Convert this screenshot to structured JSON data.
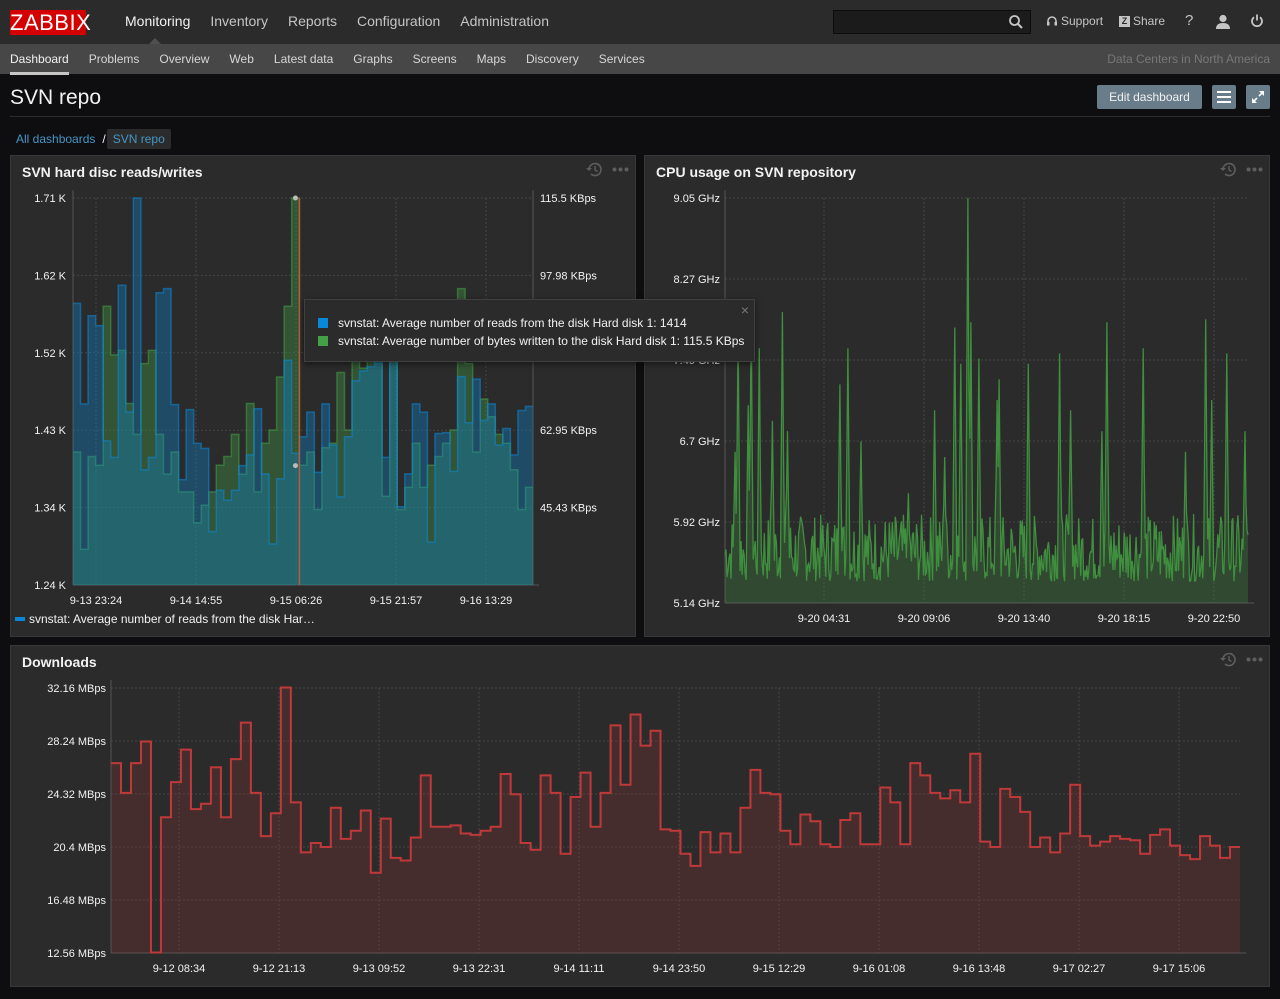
{
  "topnav": {
    "logo": "ZABBIX",
    "menu": [
      "Monitoring",
      "Inventory",
      "Reports",
      "Configuration",
      "Administration"
    ],
    "active_menu": 0,
    "search": {
      "value": "",
      "placeholder": ""
    },
    "support_label": "Support",
    "share_label": "Share",
    "share_badge": "Z",
    "help_label": "?",
    "icons": [
      "search-icon",
      "headset-icon",
      "help-icon",
      "user-icon",
      "power-icon"
    ]
  },
  "subnav": {
    "items": [
      "Dashboard",
      "Problems",
      "Overview",
      "Web",
      "Latest data",
      "Graphs",
      "Screens",
      "Maps",
      "Discovery",
      "Services"
    ],
    "active_item": 0,
    "right_text": "Data Centers in North America"
  },
  "page": {
    "title": "SVN repo",
    "edit_button": "Edit dashboard",
    "breadcrumb": {
      "root": "All dashboards",
      "separator": "/",
      "current": "SVN repo"
    }
  },
  "colors": {
    "brand": "#d40000",
    "accent_link": "#4796c4",
    "button": "#687c8a",
    "reads_series": "#0a88d8",
    "writes_series": "#43a047",
    "cpu_series": "#3f8f3f",
    "downloads_series": "#c0393a"
  },
  "widgets": {
    "disk": {
      "title": "SVN hard disc reads/writes",
      "tooltip": {
        "rows": [
          {
            "color": "#0a88d8",
            "text": "svnstat: Average number of reads from the disk Hard disk 1: 1414"
          },
          {
            "color": "#43a047",
            "text": "svnstat: Average number of bytes written to the disk Hard disk 1: 115.5 KBps"
          }
        ],
        "close": "×"
      },
      "legend": "svnstat: Average number of reads from the disk Har…"
    },
    "cpu": {
      "title": "CPU usage on SVN repository"
    },
    "downloads": {
      "title": "Downloads"
    }
  },
  "chart_data": [
    {
      "type": "area",
      "title": "SVN hard disc reads/writes",
      "x_ticks": [
        "9-13 23:24",
        "9-14 14:55",
        "9-15 06:26",
        "9-15 21:57",
        "9-16 13:29"
      ],
      "y_left_ticks": [
        "1.71 K",
        "1.62 K",
        "1.52 K",
        "1.43 K",
        "1.34 K",
        "1.24 K"
      ],
      "y_left_range": [
        1240,
        1710
      ],
      "y_right_ticks": [
        "115.5 KBps",
        "97.98 KBps",
        "62.95 KBps",
        "45.43 KBps"
      ],
      "y_right_range": [
        27.91,
        115.5
      ],
      "grid": true,
      "legend": "bottom-left",
      "hover_marker_index": 29,
      "series": [
        {
          "name": "svnstat: Average number of reads from the disk Hard disk 1",
          "axis": "left",
          "color": "#0a88d8",
          "values": [
            1582,
            1460,
            1567,
            1555,
            1415,
            1395,
            1604,
            1450,
            1710,
            1380,
            1395,
            1595,
            1600,
            1459,
            1368,
            1453,
            1412,
            1406,
            1305,
            1355,
            1343,
            1355,
            1385,
            1398,
            1454,
            1375,
            1290,
            1369,
            1513,
            1400,
            1420,
            1450,
            1377,
            1460,
            1410,
            1347,
            1420,
            1488,
            1500,
            1505,
            1510,
            1395,
            1535,
            1335,
            1375,
            1460,
            1450,
            1292,
            1424,
            1425,
            1378,
            1493,
            1437,
            1490,
            1440,
            1460,
            1410,
            1430,
            1398,
            1452,
            1457
          ]
        },
        {
          "name": "svnstat: Average number of bytes written to the disk Hard disk 1",
          "axis": "right",
          "color": "#43a047",
          "values": [
            58,
            36,
            57,
            55,
            91,
            80,
            81,
            69,
            62,
            78,
            81,
            62,
            53,
            58,
            49,
            49,
            42,
            46,
            49,
            55,
            57,
            62,
            53,
            69,
            49,
            60,
            63,
            75,
            91,
            115.5,
            55,
            58,
            45,
            59,
            60,
            76,
            63,
            85,
            77,
            80,
            78,
            48,
            86,
            45,
            50,
            60,
            50,
            55,
            57,
            60,
            63,
            95,
            78,
            58,
            70,
            66,
            62,
            60,
            54,
            45,
            50
          ]
        }
      ]
    },
    {
      "type": "area",
      "title": "CPU usage on SVN repository",
      "x_ticks": [
        "9-20 04:31",
        "9-20 09:06",
        "9-20 13:40",
        "9-20 18:15",
        "9-20 22:50"
      ],
      "y_ticks": [
        "9.05 GHz",
        "8.27 GHz",
        "7.49 GHz",
        "6.7 GHz",
        "5.92 GHz",
        "5.14 GHz"
      ],
      "y_range": [
        5.14,
        9.05
      ],
      "grid": true,
      "series": [
        {
          "name": "CPU usage",
          "color": "#3f8f3f",
          "peaks": [
            [
              0.02,
              6.6
            ],
            [
              0.025,
              7.75
            ],
            [
              0.045,
              7.05
            ],
            [
              0.05,
              7.9
            ],
            [
              0.065,
              7.6
            ],
            [
              0.09,
              6.9
            ],
            [
              0.11,
              7.95
            ],
            [
              0.12,
              6.8
            ],
            [
              0.22,
              7.25
            ],
            [
              0.235,
              7.6
            ],
            [
              0.26,
              6.7
            ],
            [
              0.35,
              6.2
            ],
            [
              0.4,
              7.0
            ],
            [
              0.42,
              6.55
            ],
            [
              0.44,
              7.8
            ],
            [
              0.45,
              7.45
            ],
            [
              0.47,
              7.85
            ],
            [
              0.485,
              7.5
            ],
            [
              0.465,
              9.05
            ],
            [
              0.52,
              7.1
            ],
            [
              0.525,
              7.3
            ],
            [
              0.58,
              7.45
            ],
            [
              0.64,
              7.55
            ],
            [
              0.66,
              7.0
            ],
            [
              0.72,
              6.8
            ],
            [
              0.73,
              7.85
            ],
            [
              0.8,
              7.6
            ],
            [
              0.88,
              6.6
            ],
            [
              0.92,
              7.88
            ],
            [
              0.93,
              7.1
            ],
            [
              0.96,
              7.55
            ],
            [
              0.995,
              6.8
            ]
          ],
          "baseline_range": [
            5.35,
            6.0
          ]
        }
      ]
    },
    {
      "type": "line",
      "title": "Downloads",
      "x_ticks": [
        "9-12 08:34",
        "9-12 21:13",
        "9-13 09:52",
        "9-13 22:31",
        "9-14 11:11",
        "9-14 23:50",
        "9-15 12:29",
        "9-16 01:08",
        "9-16 13:48",
        "9-17 02:27",
        "9-17 15:06"
      ],
      "y_ticks": [
        "32.16 MBps",
        "28.24 MBps",
        "24.32 MBps",
        "20.4 MBps",
        "16.48 MBps",
        "12.56 MBps"
      ],
      "y_range": [
        12.56,
        32.16
      ],
      "grid": true,
      "series": [
        {
          "name": "Downloads",
          "color": "#c0393a",
          "values": [
            26.6,
            24.4,
            26.6,
            28.2,
            12.6,
            22.6,
            25.2,
            27.6,
            23.2,
            23.6,
            26.3,
            22.6,
            26.9,
            29.6,
            24.4,
            21.2,
            22.9,
            32.2,
            23.7,
            20.0,
            20.7,
            20.4,
            23.3,
            21.0,
            21.6,
            23.1,
            18.5,
            22.5,
            19.6,
            19.4,
            21.1,
            25.7,
            21.9,
            21.9,
            22.0,
            21.4,
            21.3,
            21.6,
            21.9,
            25.8,
            24.3,
            20.7,
            20.2,
            25.7,
            24.4,
            19.9,
            24.1,
            25.9,
            21.9,
            24.4,
            29.4,
            25.0,
            30.2,
            27.9,
            29.0,
            21.7,
            21.6,
            19.9,
            19.0,
            21.5,
            20.0,
            21.4,
            20.0,
            23.3,
            26.1,
            24.4,
            24.3,
            21.6,
            20.6,
            22.8,
            22.3,
            20.6,
            20.4,
            22.4,
            22.9,
            20.6,
            20.6,
            24.8,
            23.7,
            20.6,
            26.6,
            25.7,
            24.4,
            24.0,
            24.6,
            23.7,
            27.3,
            20.8,
            20.4,
            24.7,
            24.1,
            23.0,
            20.4,
            21.1,
            20.0,
            21.4,
            25.0,
            21.2,
            20.5,
            20.8,
            21.2,
            21.0,
            20.9,
            19.9,
            21.3,
            21.7,
            20.5,
            19.8,
            19.5,
            21.2,
            20.5,
            19.6,
            20.4
          ]
        }
      ]
    }
  ]
}
